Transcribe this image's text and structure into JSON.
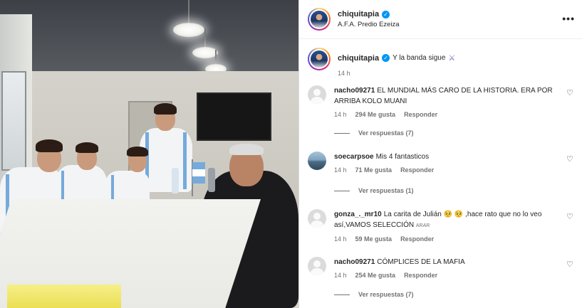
{
  "post": {
    "header": {
      "username": "chiquitapia",
      "verified_glyph": "✓",
      "location": "A.F.A. Predio Ezeiza",
      "more_glyph": "•••"
    },
    "caption": {
      "username": "chiquitapia",
      "text": "Y la banda sigue",
      "emoji": "⚔",
      "time": "14 h"
    },
    "comments": [
      {
        "username": "nacho09271",
        "text": "EL MUNDIAL MÁS CARO DE LA HISTORIA. ERA POR ARRIBA KOLO MUANI",
        "time": "14 h",
        "likes": "294 Me gusta",
        "reply": "Responder",
        "replies": "Ver respuestas (7)",
        "avatar": "default-avatar-icon"
      },
      {
        "username": "soecarpsoe",
        "text": "Mis 4 fantasticos",
        "time": "14 h",
        "likes": "71 Me gusta",
        "reply": "Responder",
        "replies": "Ver respuestas (1)",
        "avatar": "sea-photo-avatar"
      },
      {
        "username": "gonza_._mr10",
        "text": "La carita de Julián 🥺 🥺 ,hace rato que no lo veo así,VAMOS SELECCIÓN",
        "text_suffix": "ARAR",
        "time": "14 h",
        "likes": "59 Me gusta",
        "reply": "Responder",
        "avatar": "default-avatar-icon"
      },
      {
        "username": "nacho09271",
        "text": "CÓMPLICES DE LA MAFIA",
        "time": "14 h",
        "likes": "254 Me gusta",
        "reply": "Responder",
        "replies": "Ver respuestas (7)",
        "avatar": "default-avatar-icon"
      }
    ],
    "like_glyph": "♡",
    "colors": {
      "verified": "#0095f6",
      "muted_text": "#737373",
      "divider": "#dbdbdb",
      "shirt_stripe": "#75aadb"
    }
  }
}
